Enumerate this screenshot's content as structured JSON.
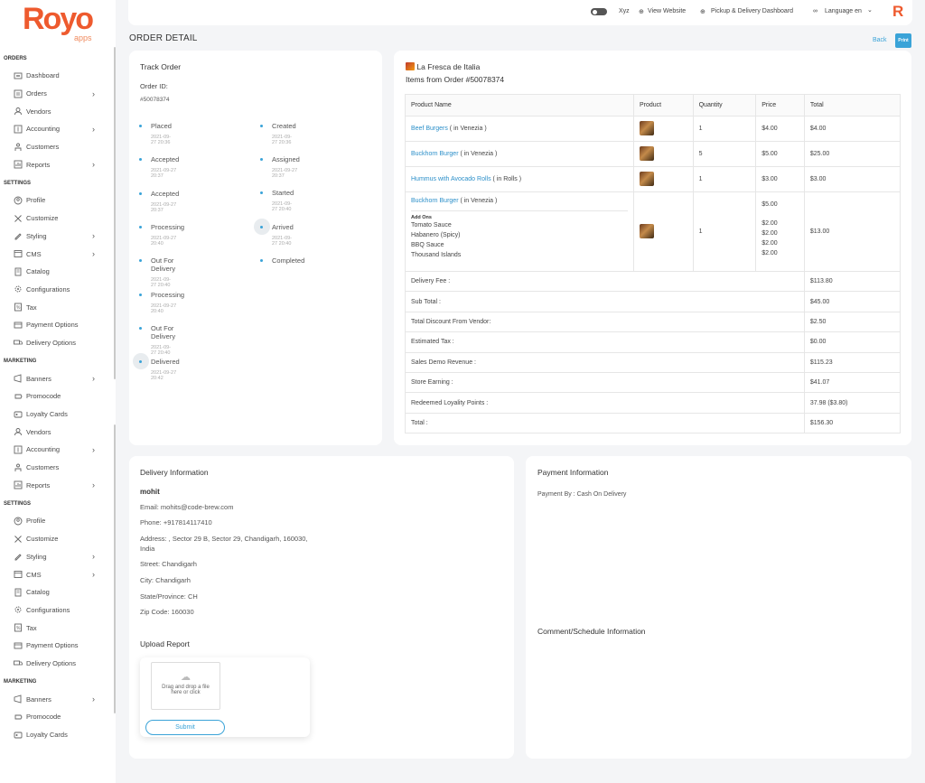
{
  "brand": {
    "name": "Royo",
    "sub": "apps",
    "small": "R"
  },
  "sidebar": {
    "sections": [
      {
        "title": "ORDERS",
        "items": [
          {
            "label": "Dashboard",
            "icon": "dashboard-icon",
            "chev": false
          },
          {
            "label": "Orders",
            "icon": "orders-icon",
            "chev": true
          },
          {
            "label": "Vendors",
            "icon": "vendors-icon",
            "chev": false
          },
          {
            "label": "Accounting",
            "icon": "accounting-icon",
            "chev": true
          },
          {
            "label": "Customers",
            "icon": "customers-icon",
            "chev": false
          },
          {
            "label": "Reports",
            "icon": "reports-icon",
            "chev": true
          }
        ]
      },
      {
        "title": "SETTINGS",
        "items": [
          {
            "label": "Profile",
            "icon": "profile-icon",
            "chev": false
          },
          {
            "label": "Customize",
            "icon": "customize-icon",
            "chev": false
          },
          {
            "label": "Styling",
            "icon": "styling-icon",
            "chev": true
          },
          {
            "label": "CMS",
            "icon": "cms-icon",
            "chev": true
          },
          {
            "label": "Catalog",
            "icon": "catalog-icon",
            "chev": false
          },
          {
            "label": "Configurations",
            "icon": "configurations-icon",
            "chev": false
          },
          {
            "label": "Tax",
            "icon": "tax-icon",
            "chev": false
          },
          {
            "label": "Payment Options",
            "icon": "payment-options-icon",
            "chev": false
          },
          {
            "label": "Delivery Options",
            "icon": "delivery-options-icon",
            "chev": false
          }
        ]
      },
      {
        "title": "MARKETING",
        "items": [
          {
            "label": "Banners",
            "icon": "banners-icon",
            "chev": true
          },
          {
            "label": "Promocode",
            "icon": "promocode-icon",
            "chev": false
          },
          {
            "label": "Loyalty Cards",
            "icon": "loyalty-cards-icon",
            "chev": false
          },
          {
            "label": "Vendors",
            "icon": "vendors-icon",
            "chev": false
          },
          {
            "label": "Accounting",
            "icon": "accounting-icon",
            "chev": true
          },
          {
            "label": "Customers",
            "icon": "customers-icon",
            "chev": false
          },
          {
            "label": "Reports",
            "icon": "reports-icon",
            "chev": true
          }
        ]
      },
      {
        "title": "SETTINGS",
        "items": [
          {
            "label": "Profile",
            "icon": "profile-icon",
            "chev": false
          },
          {
            "label": "Customize",
            "icon": "customize-icon",
            "chev": false
          },
          {
            "label": "Styling",
            "icon": "styling-icon",
            "chev": true
          },
          {
            "label": "CMS",
            "icon": "cms-icon",
            "chev": true
          },
          {
            "label": "Catalog",
            "icon": "catalog-icon",
            "chev": false
          },
          {
            "label": "Configurations",
            "icon": "configurations-icon",
            "chev": false
          },
          {
            "label": "Tax",
            "icon": "tax-icon",
            "chev": false
          },
          {
            "label": "Payment Options",
            "icon": "payment-options-icon",
            "chev": false
          },
          {
            "label": "Delivery Options",
            "icon": "delivery-options-icon",
            "chev": false
          }
        ]
      },
      {
        "title": "MARKETING",
        "items": [
          {
            "label": "Banners",
            "icon": "banners-icon",
            "chev": true
          },
          {
            "label": "Promocode",
            "icon": "promocode-icon",
            "chev": false
          },
          {
            "label": "Loyalty Cards",
            "icon": "loyalty-cards-icon",
            "chev": false
          }
        ]
      }
    ]
  },
  "topbar": {
    "toggle_label": "Xyz",
    "view_website": "View Website",
    "pickup_dashboard": "Pickup & Delivery Dashboard",
    "language": "Language en",
    "language_caret": "⌄"
  },
  "page": {
    "title": "ORDER DETAIL",
    "back": "Back",
    "print": "Print"
  },
  "track": {
    "title": "Track Order",
    "order_id_label": "Order ID:",
    "order_id": "#50078374",
    "left_steps": [
      {
        "name": "Placed",
        "date": "2021-09-27 20:36"
      },
      {
        "name": "Accepted",
        "date": "2021-09-27 20:37"
      },
      {
        "name": "Accepted",
        "date": "2021-09-27 20:37"
      },
      {
        "name": "Processing",
        "date": "2021-09-27 20:40"
      },
      {
        "name": "Out For Delivery",
        "date": "2021-09-27 20:40"
      },
      {
        "name": "Processing",
        "date": "2021-09-27 20:40"
      },
      {
        "name": "Out For Delivery",
        "date": "2021-09-27 20:40"
      },
      {
        "name": "Delivered",
        "date": "2021-09-27 20:42"
      }
    ],
    "right_steps": [
      {
        "name": "Created",
        "date": "2021-09-27 20:36"
      },
      {
        "name": "Assigned",
        "date": "2021-09-27 20:37"
      },
      {
        "name": "Started",
        "date": "2021-09-27 20:40"
      },
      {
        "name": "Arrived",
        "date": "2021-09-27 20:40"
      },
      {
        "name": "Completed",
        "date": ""
      }
    ]
  },
  "vendor": {
    "name": "La Fresca de Italia",
    "items_title": "Items from Order #50078374"
  },
  "items_table": {
    "headers": [
      "Product Name",
      "Product",
      "Quantity",
      "Price",
      "Total"
    ],
    "rows": [
      {
        "name": "Beef Burgers",
        "variant": " ( in Venezia )",
        "qty": "1",
        "price": "$4.00",
        "total": "$4.00"
      },
      {
        "name": "Buckhorn Burger",
        "variant": " ( in Venezia )",
        "qty": "5",
        "price": "$5.00",
        "total": "$25.00"
      },
      {
        "name": "Hummus with Avocado Rolls",
        "variant": " ( in Rolls )",
        "qty": "1",
        "price": "$3.00",
        "total": "$3.00"
      }
    ],
    "addon_row": {
      "name": "Buckhorn Burger",
      "variant": " ( in Venezia )",
      "addons_label": "Add Ons",
      "addons": [
        "Tomato Sauce",
        "Habanero (Spicy)",
        "BBQ Sauce",
        "Thousand Islands"
      ],
      "qty": "1",
      "price": "$5.00",
      "addon_prices": [
        "$2.00",
        "$2.00",
        "$2.00",
        "$2.00"
      ],
      "total": "$13.00"
    },
    "summary": [
      {
        "label": "Delivery Fee :",
        "value": "$113.80"
      },
      {
        "label": "Sub Total :",
        "value": "$45.00"
      },
      {
        "label": "Total Discount From Vendor:",
        "value": "$2.50"
      },
      {
        "label": "Estimated Tax :",
        "value": "$0.00"
      },
      {
        "label": "Sales Demo Revenue :",
        "value": "$115.23"
      },
      {
        "label": "Store Earning :",
        "value": "$41.07"
      },
      {
        "label": "Redeemed Loyality Points :",
        "value": "37.98 ($3.80)"
      },
      {
        "label": "Total :",
        "value": "$156.30"
      }
    ]
  },
  "delivery": {
    "title": "Delivery Information",
    "name": "mohit",
    "email": "Email: mohits@code-brew.com",
    "phone": "Phone: +917814117410",
    "address_line1": "Address: , Sector 29 B, Sector 29, Chandigarh, 160030,",
    "address_line2": "India",
    "street": "Street: Chandigarh",
    "city": "City: Chandigarh",
    "state": "State/Province: CH",
    "zip": "Zip Code: 160030",
    "upload_title": "Upload Report",
    "upload_text1": "Drag and drop a file",
    "upload_text2": "here or click",
    "submit": "Submit"
  },
  "payment": {
    "title": "Payment Information",
    "by": "Payment By : Cash On Delivery",
    "comment_title": "Comment/Schedule Information"
  },
  "colors": {
    "accent": "#3aa3d8",
    "brand": "#ee5a2e"
  }
}
